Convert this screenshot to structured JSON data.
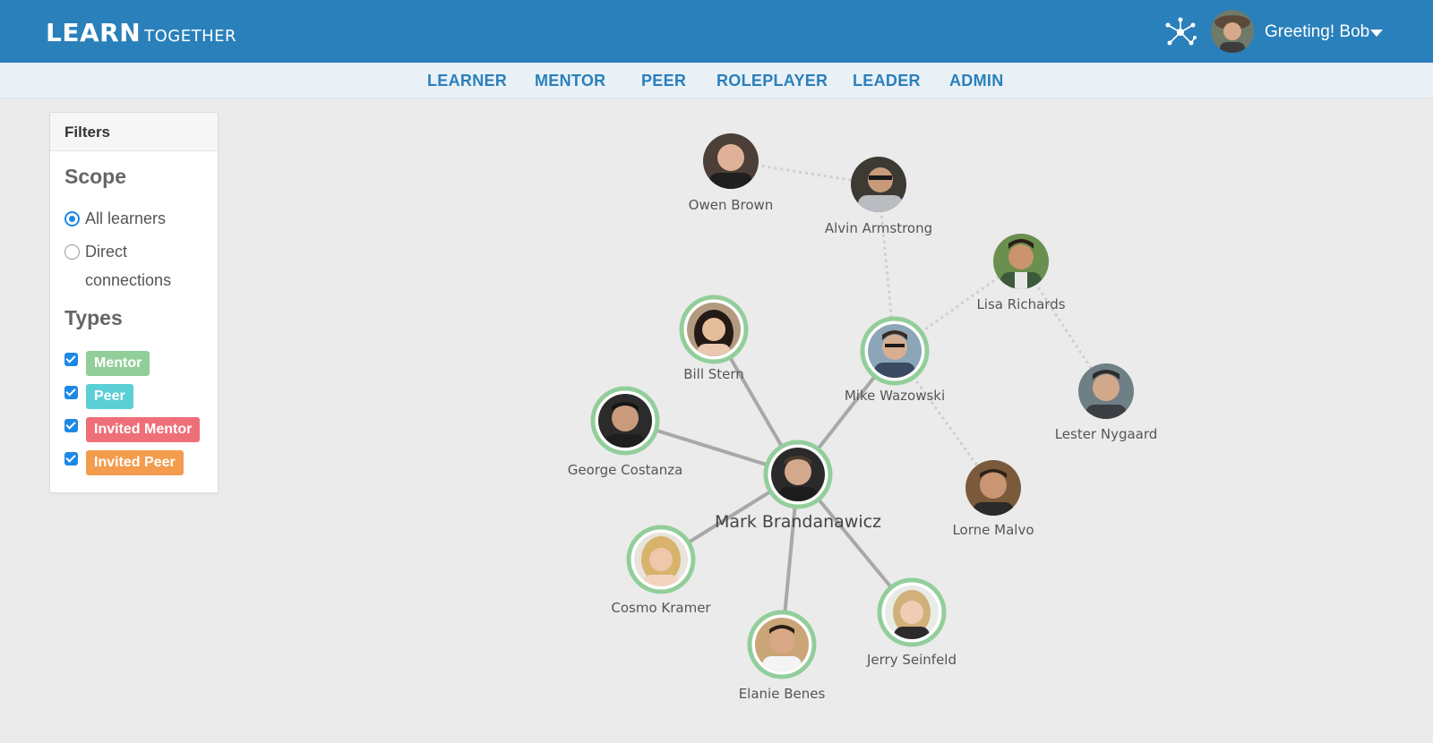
{
  "header": {
    "brand_strong": "LEARN",
    "brand_light": "TOGETHER",
    "greeting": "Greeting! Bob",
    "network_icon": "network-icon",
    "colors": {
      "bar": "#2a80bb"
    }
  },
  "nav": {
    "items": [
      "LEARNER",
      "MENTOR",
      "PEER",
      "ROLEPLAYER",
      "LEADER",
      "ADMIN"
    ]
  },
  "filters": {
    "title": "Filters",
    "scope": {
      "title": "Scope",
      "options": [
        {
          "label": "All learners",
          "checked": true
        },
        {
          "label_line1": "Direct",
          "label_line2": "connections",
          "checked": false
        }
      ]
    },
    "types": {
      "title": "Types",
      "items": [
        {
          "label": "Mentor",
          "checked": true,
          "color": "#92ce9a"
        },
        {
          "label": "Peer",
          "checked": true,
          "color": "#5bcfd6"
        },
        {
          "label": "Invited Mentor",
          "checked": true,
          "color": "#ef6f78"
        },
        {
          "label": "Invited Peer",
          "checked": true,
          "color": "#f39c4e"
        }
      ]
    }
  },
  "graph": {
    "center": "Mark Brandanawicz",
    "nodes": [
      {
        "id": "mark",
        "name": "Mark Brandanawicz",
        "ring": "#92ce9a"
      },
      {
        "id": "bill",
        "name": "Bill Stern",
        "ring": "#92ce9a"
      },
      {
        "id": "george",
        "name": "George Costanza",
        "ring": "#92ce9a"
      },
      {
        "id": "cosmo",
        "name": "Cosmo Kramer",
        "ring": "#92ce9a"
      },
      {
        "id": "elanie",
        "name": "Elanie Benes",
        "ring": "#92ce9a"
      },
      {
        "id": "jerry",
        "name": "Jerry Seinfeld",
        "ring": "#92ce9a"
      },
      {
        "id": "mike",
        "name": "Mike Wazowski",
        "ring": "#92ce9a"
      },
      {
        "id": "owen",
        "name": "Owen Brown",
        "ring": null
      },
      {
        "id": "alvin",
        "name": "Alvin Armstrong",
        "ring": null
      },
      {
        "id": "lisa",
        "name": "Lisa Richards",
        "ring": null
      },
      {
        "id": "lester",
        "name": "Lester Nygaard",
        "ring": null
      },
      {
        "id": "lorne",
        "name": "Lorne Malvo",
        "ring": null
      }
    ],
    "direct_edges": [
      [
        "mark",
        "bill"
      ],
      [
        "mark",
        "george"
      ],
      [
        "mark",
        "cosmo"
      ],
      [
        "mark",
        "elanie"
      ],
      [
        "mark",
        "jerry"
      ],
      [
        "mark",
        "mike"
      ]
    ],
    "indirect_edges": [
      [
        "owen",
        "alvin"
      ],
      [
        "alvin",
        "mike"
      ],
      [
        "mike",
        "lisa"
      ],
      [
        "lisa",
        "lester"
      ],
      [
        "mike",
        "lorne"
      ]
    ]
  }
}
